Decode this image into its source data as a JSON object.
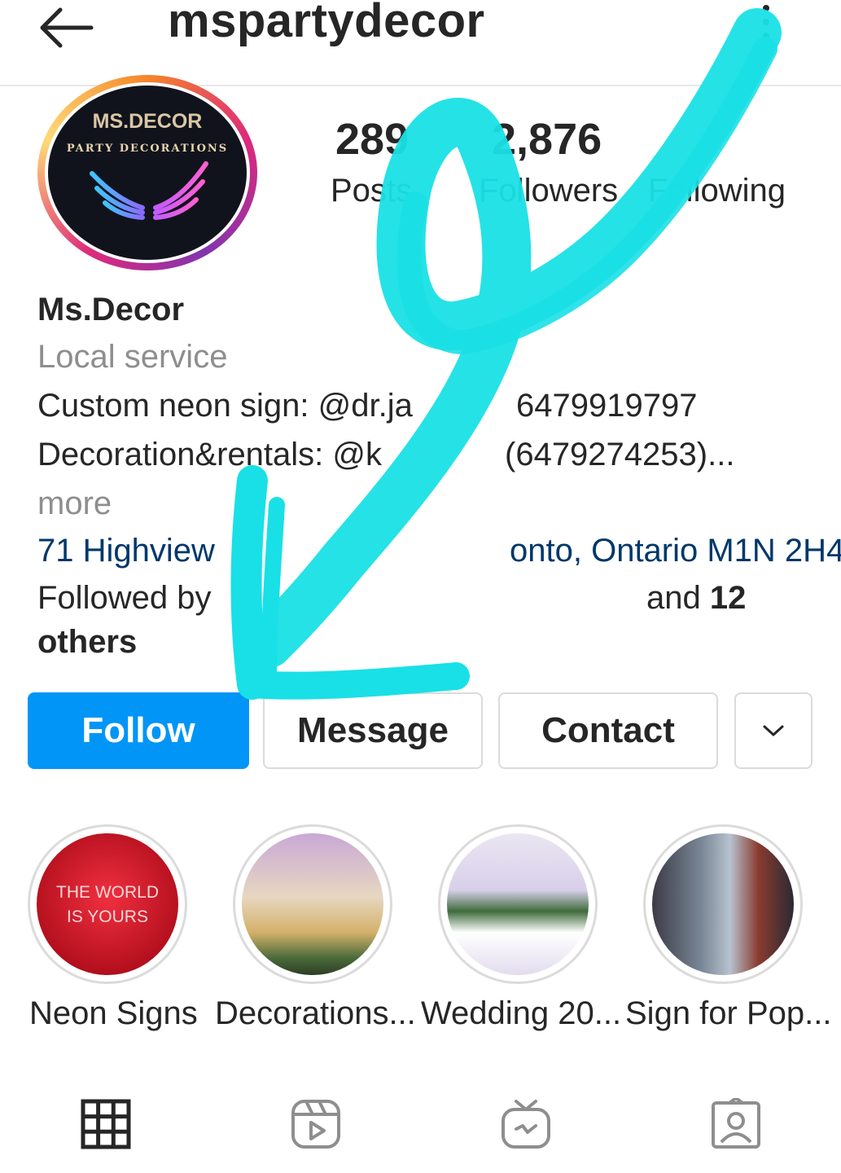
{
  "header": {
    "username": "mspartydecor",
    "back_icon": "arrow-left-icon",
    "more_icon": "more-vertical-icon"
  },
  "profile": {
    "logo_title": "MS.DECOR",
    "logo_subtitle": "PARTY DECORATIONS",
    "stats": {
      "posts_count": "289",
      "posts_label": "Posts",
      "followers_count": "2,876",
      "followers_label": "Followers",
      "following_label": "Following"
    },
    "bio": {
      "name": "Ms.Decor",
      "category": "Local service",
      "line1": "Custom neon sign: @dr.ja",
      "line1_phone": "6479919797",
      "line2": "Decoration&rentals: @k",
      "line2_phone": "(6479274253)...",
      "more": "more",
      "address_start": "71 Highview",
      "address_end": "onto, Ontario M1N 2H4",
      "followed_prefix": "Followed by",
      "followed_suffix": "and ",
      "followed_count": "12",
      "followed_others": "others"
    }
  },
  "actions": {
    "follow": "Follow",
    "message": "Message",
    "contact": "Contact",
    "dropdown_icon": "chevron-down-icon"
  },
  "highlights": [
    {
      "label": "Neon Signs",
      "image_text_1": "THE WORLD",
      "image_text_2": "IS YOURS"
    },
    {
      "label": "Decorations..."
    },
    {
      "label": "Wedding 20..."
    },
    {
      "label": "Sign for Pop..."
    }
  ],
  "tabs": [
    "grid-icon",
    "reels-icon",
    "igtv-icon",
    "tagged-icon"
  ],
  "colors": {
    "accent": "#0095f6",
    "scribble": "#19e0e6",
    "link": "#00376b"
  }
}
